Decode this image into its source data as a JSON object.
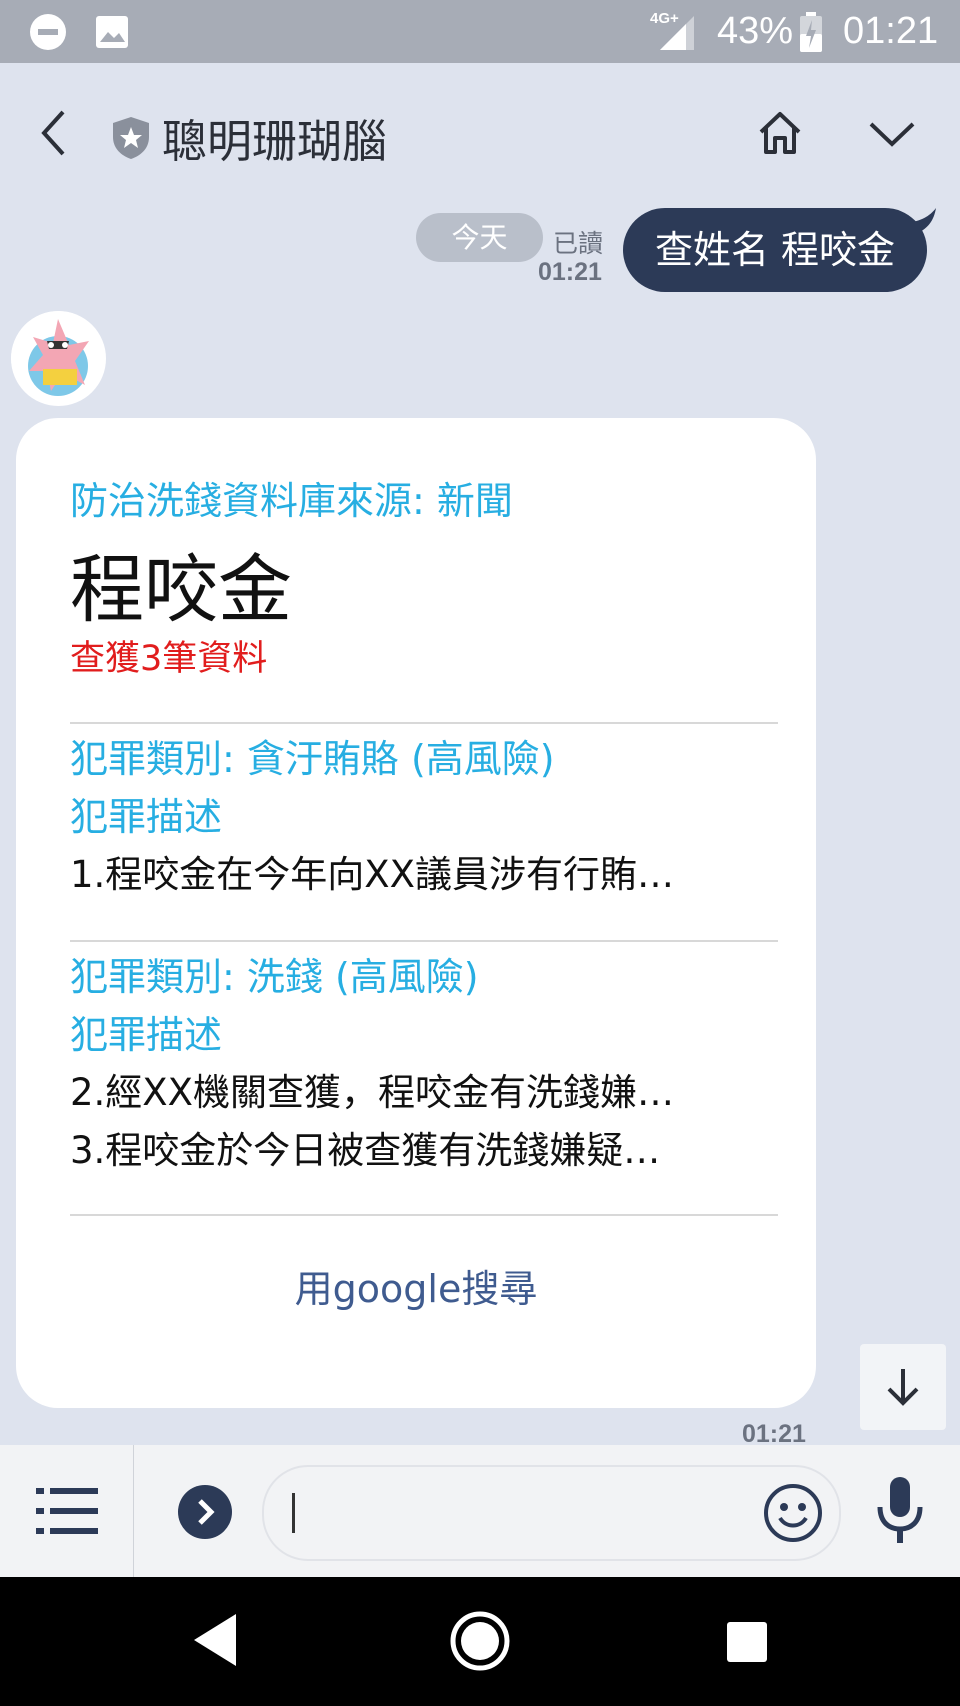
{
  "status_bar": {
    "network": "4G+",
    "battery": "43%",
    "time": "01:21"
  },
  "header": {
    "title": "聰明珊瑚腦"
  },
  "chat": {
    "date_divider": "今天",
    "read_label": "已讀",
    "user_message_time": "01:21",
    "user_message": "查姓名 程咬金",
    "bot_message_time": "01:21"
  },
  "card": {
    "source": "防治洗錢資料庫來源: 新聞",
    "name": "程咬金",
    "result_count": "查獲3筆資料",
    "groups": [
      {
        "category": "犯罪類別: 貪汙賄賂 (高風險)",
        "desc_heading": "犯罪描述",
        "lines": [
          "1.程咬金在今年向XX議員涉有行賄…"
        ]
      },
      {
        "category": "犯罪類別: 洗錢 (高風險)",
        "desc_heading": "犯罪描述",
        "lines": [
          "2.經XX機關查獲，程咬金有洗錢嫌…",
          "3.程咬金於今日被查獲有洗錢嫌疑…"
        ]
      }
    ],
    "action_label": "用google搜尋"
  },
  "input_bar": {
    "placeholder": ""
  },
  "colors": {
    "chat_bg": "#dee3ee",
    "user_bubble": "#2c3a57",
    "accent_blue": "#27aee2",
    "count_red": "#e11d1d",
    "link_blue": "#3f5b8f"
  }
}
